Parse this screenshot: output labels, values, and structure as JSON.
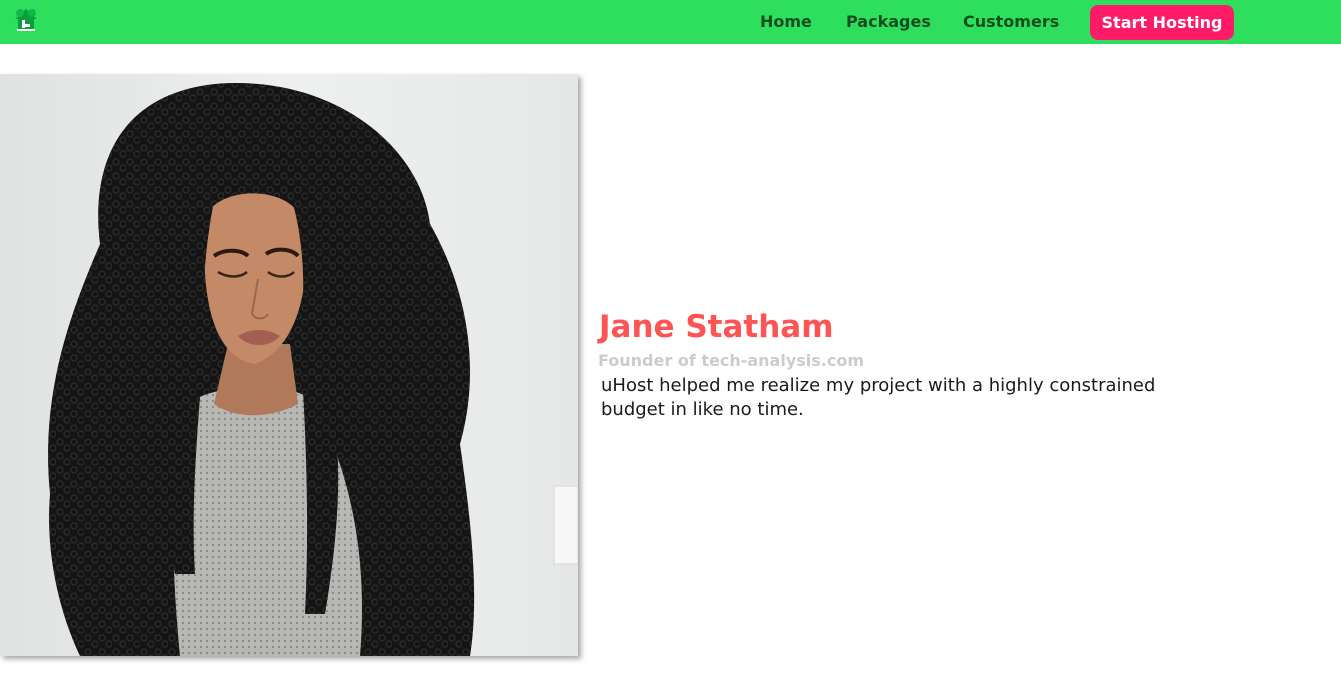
{
  "brand": {
    "logo_icon": "house-logo-icon"
  },
  "nav": {
    "items": [
      {
        "label": "Home"
      },
      {
        "label": "Packages"
      },
      {
        "label": "Customers"
      }
    ],
    "cta_label": "Start Hosting"
  },
  "colors": {
    "header_bg": "#2ddf5c",
    "nav_text": "#0e4f1f",
    "cta_bg": "#ff1b68",
    "name": "#ff5454",
    "subtitle": "#cccccc"
  },
  "testimonial": {
    "name": "Jane Statham",
    "subtitle": "Founder of tech-analysis.com",
    "quote": "uHost helped me realize my project with a highly constrained budget in like no time."
  }
}
